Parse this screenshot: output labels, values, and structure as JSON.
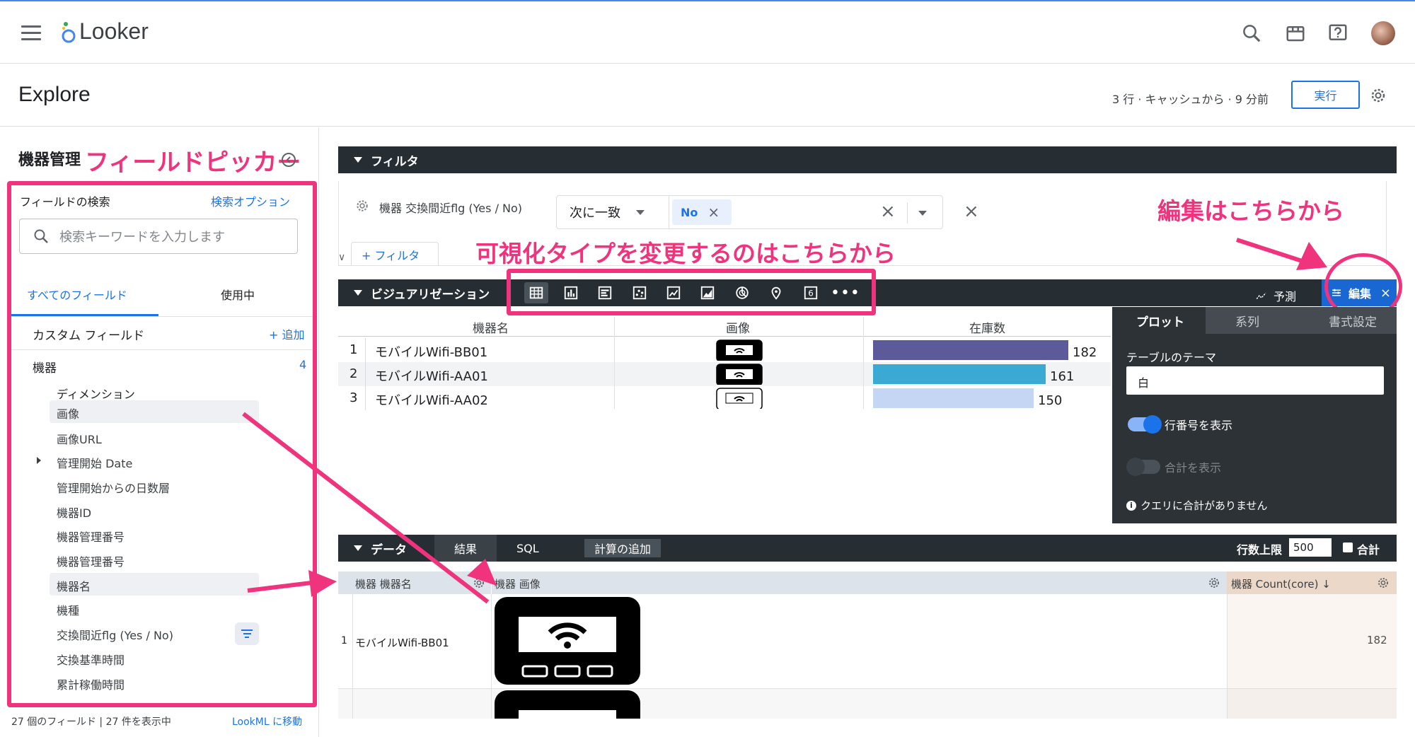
{
  "app": {
    "name": "Looker"
  },
  "header": {
    "title": "Explore",
    "cache_status": "3 行 · キャッシュから · 9 分前",
    "run_label": "実行"
  },
  "field_picker": {
    "title": "機器管理",
    "annotation": "フィールドピッカー",
    "search_label": "フィールドの検索",
    "search_options": "検索オプション",
    "search_placeholder": "検索キーワードを入力します",
    "tab_all": "すべてのフィールド",
    "tab_in_use": "使用中",
    "custom_fields": "カスタム フィールド",
    "add_label": "+ 追加",
    "view_name": "機器",
    "view_count": "4",
    "dimension_header": "ディメンション",
    "fields": [
      "画像",
      "画像URL",
      "管理開始 Date",
      "管理開始からの日数層",
      "機器ID",
      "機器管理番号",
      "機器管理番号",
      "機器名",
      "機種",
      "交換間近flg (Yes / No)",
      "交換基準時間",
      "累計稼働時間"
    ],
    "footer_count": "27 個のフィールド | 27 件を表示中",
    "footer_link": "LookML に移動"
  },
  "filters": {
    "bar_title": "フィルタ",
    "field": "機器 交換間近flg (Yes / No)",
    "operator": "次に一致",
    "value_chip": "No",
    "add_filter": "+ フィルタ"
  },
  "annotations": {
    "vis_type": "可視化タイプを変更するのはこちらから",
    "edit": "編集はこちらから"
  },
  "visualization": {
    "bar_title": "ビジュアリゼーション",
    "forecast": "予測",
    "edit": "編集",
    "icons": [
      "table-icon",
      "column-chart-icon",
      "bar-chart-icon",
      "scatter-icon",
      "line-chart-icon",
      "area-chart-icon",
      "pie-chart-icon",
      "map-pin-icon",
      "single-value-icon",
      "more-icon"
    ],
    "columns": [
      "機器名",
      "画像",
      "在庫数"
    ],
    "rows": [
      {
        "num": "1",
        "name": "モバイルWifi-BB01",
        "value": 182,
        "label": "182",
        "color": "#5c5a9b"
      },
      {
        "num": "2",
        "name": "モバイルWifi-AA01",
        "value": 161,
        "label": "161",
        "color": "#3aa9d4"
      },
      {
        "num": "3",
        "name": "モバイルWifi-AA02",
        "value": 150,
        "label": "150",
        "color": "#c5d5f4"
      }
    ],
    "max_value": 182
  },
  "edit_panel": {
    "tabs": [
      "プロット",
      "系列",
      "書式設定"
    ],
    "theme_label": "テーブルのテーマ",
    "theme_value": "白",
    "show_row_numbers": "行番号を表示",
    "show_totals": "合計を表示",
    "no_totals_note": "クエリに合計がありません"
  },
  "data": {
    "bar_title": "データ",
    "tab_results": "結果",
    "tab_sql": "SQL",
    "add_calc": "計算の追加",
    "row_limit_label": "行数上限",
    "row_limit_value": "500",
    "totals_label": "合計",
    "col1": "機器 機器名",
    "col2": "機器 画像",
    "col3": "機器 Count(core) ↓",
    "row1": {
      "num": "1",
      "name": "モバイルWifi-BB01",
      "count": "182"
    }
  }
}
